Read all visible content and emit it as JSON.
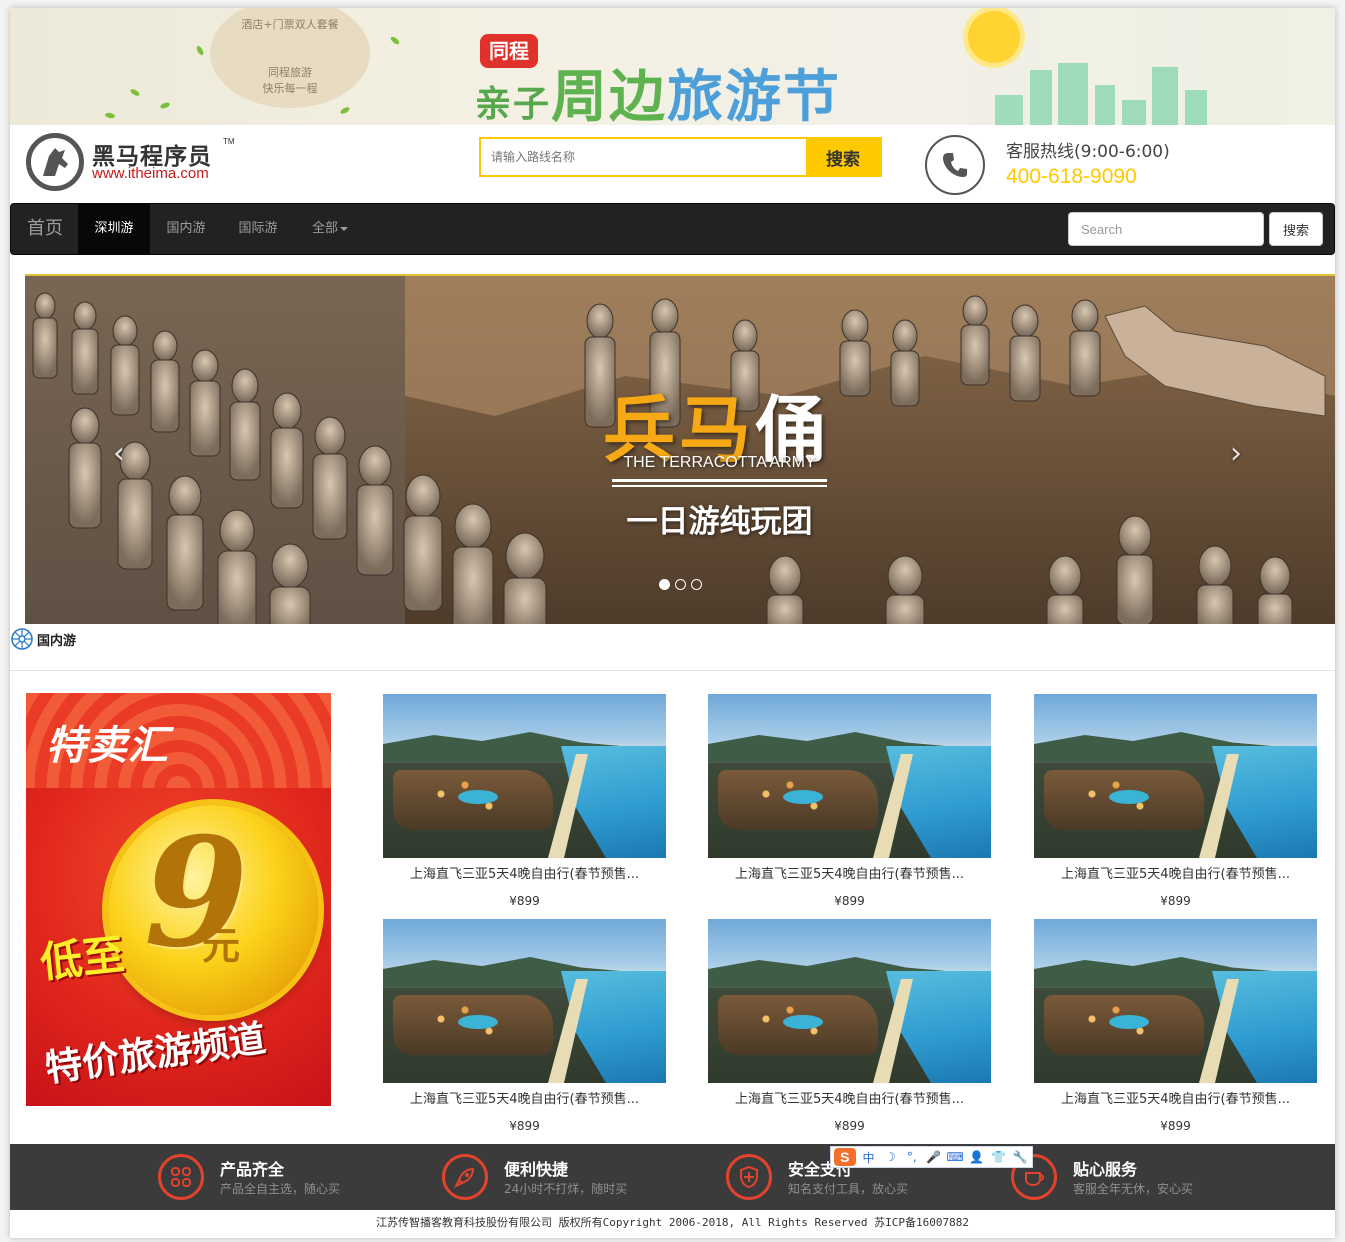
{
  "top_banner": {
    "left_text_1": "酒店+门票双人套餐",
    "left_text_2": "同程旅游",
    "left_text_3": "快乐每一程",
    "badge": "同程",
    "title_part1": "亲子",
    "title_part2": "周边",
    "title_part3": "旅游节"
  },
  "header": {
    "logo_cn": "黑马程序员",
    "logo_tm": "TM",
    "logo_url": "www.itheima.com",
    "search_placeholder": "请输入路线名称",
    "search_button": "搜索",
    "hotline_label": "客服热线(9:00-6:00)",
    "hotline_number": "400-618-9090",
    "accent_color": "#ffc900"
  },
  "navbar": {
    "brand": "首页",
    "items": [
      {
        "label": "深圳游",
        "active": true
      },
      {
        "label": "国内游",
        "active": false
      },
      {
        "label": "国际游",
        "active": false
      },
      {
        "label": "全部",
        "active": false,
        "dropdown": true
      }
    ],
    "search_placeholder": "Search",
    "search_button": "搜索"
  },
  "carousel": {
    "title_gold": "兵马",
    "title_white": "俑",
    "subtitle_en": "THE TERRACOTTA ARMY",
    "tagline": "一日游纯玩团",
    "prev_icon": "chevron-left-icon",
    "next_icon": "chevron-right-icon",
    "slide_count": 3,
    "active_slide": 1
  },
  "section": {
    "title": "国内游",
    "icon": "globe-icon"
  },
  "promo": {
    "brand": "特卖汇",
    "big_number": "9",
    "unit": "元",
    "prefix": "低至",
    "channel": "特价旅游频道"
  },
  "products": [
    {
      "title": "上海直飞三亚5天4晚自由行(春节预售...",
      "price": "¥899"
    },
    {
      "title": "上海直飞三亚5天4晚自由行(春节预售...",
      "price": "¥899"
    },
    {
      "title": "上海直飞三亚5天4晚自由行(春节预售...",
      "price": "¥899"
    },
    {
      "title": "上海直飞三亚5天4晚自由行(春节预售...",
      "price": "¥899"
    },
    {
      "title": "上海直飞三亚5天4晚自由行(春节预售...",
      "price": "¥899"
    },
    {
      "title": "上海直飞三亚5天4晚自由行(春节预售...",
      "price": "¥899"
    }
  ],
  "features": [
    {
      "title": "产品齐全",
      "desc": "产品全自主选，随心买",
      "icon": "grid-icon"
    },
    {
      "title": "便利快捷",
      "desc": "24小时不打烊，随时买",
      "icon": "rocket-icon"
    },
    {
      "title": "安全支付",
      "desc": "知名支付工具，放心买",
      "icon": "shield-icon"
    },
    {
      "title": "贴心服务",
      "desc": "客服全年无休，安心买",
      "icon": "cup-icon"
    }
  ],
  "ime_toolbar": {
    "logo": "S",
    "items": [
      "中",
      "☽",
      "°,",
      "🎤",
      "⌨",
      "👤",
      "👕",
      "🔧"
    ]
  },
  "footer": {
    "copyright": "江苏传智播客教育科技股份有限公司 版权所有Copyright 2006-2018, All Rights Reserved 苏ICP备16007882"
  }
}
